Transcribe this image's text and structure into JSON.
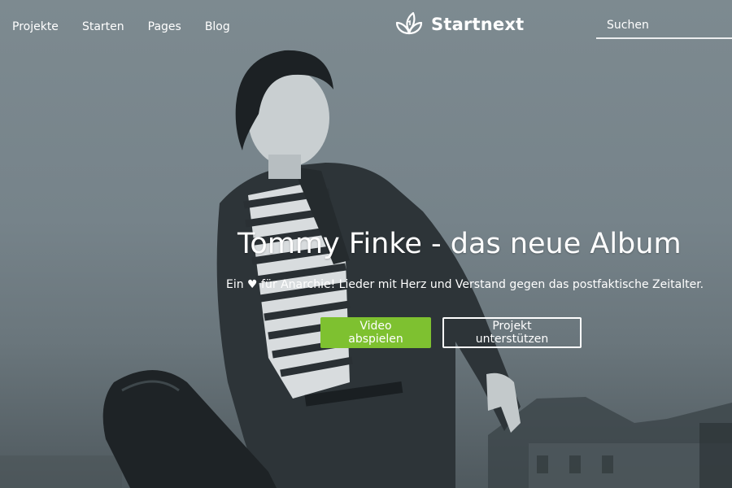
{
  "nav": {
    "items": [
      {
        "label": "Projekte"
      },
      {
        "label": "Starten"
      },
      {
        "label": "Pages"
      },
      {
        "label": "Blog"
      }
    ]
  },
  "brand": {
    "name": "Startnext",
    "icon": "leaf-logo-icon"
  },
  "search": {
    "placeholder": "Suchen",
    "value": ""
  },
  "hero": {
    "title": "Tommy Finke - das neue Album",
    "subtitle": "Ein ♥ für Anarchie! Lieder mit Herz und Verstand gegen das postfaktische Zeitalter.",
    "primary_button": "Video abspielen",
    "secondary_button": "Projekt unterstützen"
  },
  "colors": {
    "accent": "#7ec130",
    "overlay": "#7d8a90",
    "text": "#ffffff"
  }
}
